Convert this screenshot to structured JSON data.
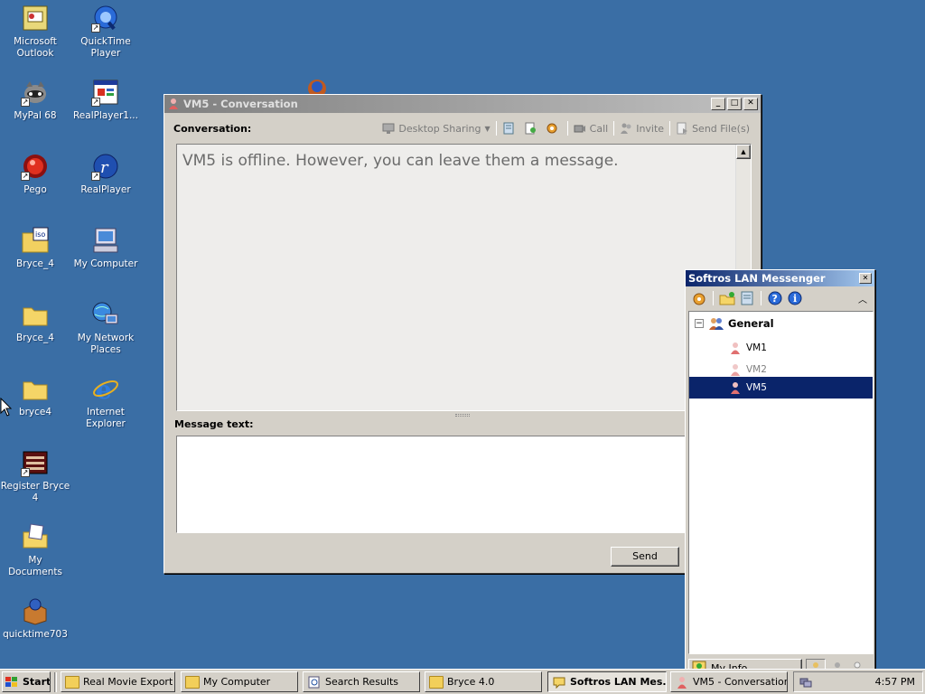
{
  "desktop": {
    "icons": [
      {
        "label": "Microsoft Outlook"
      },
      {
        "label": "QuickTime Player"
      },
      {
        "label": "MyPal 68"
      },
      {
        "label": "RealPlayer1..."
      },
      {
        "label": "Pego"
      },
      {
        "label": "RealPlayer"
      },
      {
        "label": "Bryce_4"
      },
      {
        "label": "My Computer"
      },
      {
        "label": "Bryce_4"
      },
      {
        "label": "My Network Places"
      },
      {
        "label": "bryce4"
      },
      {
        "label": "Internet Explorer"
      },
      {
        "label": "Register Bryce 4"
      },
      {
        "label": "My Documents"
      },
      {
        "label": "quicktime703"
      }
    ],
    "iso_badge": "iso"
  },
  "conversation_window": {
    "title": "VM5 - Conversation",
    "conversation_label": "Conversation:",
    "toolbar": {
      "desktop_sharing": "Desktop Sharing",
      "call": "Call",
      "invite": "Invite",
      "send_files": "Send File(s)"
    },
    "offline_message": "VM5 is offline. However, you can leave them a message.",
    "message_label": "Message text:",
    "message_value": "",
    "send_label": "Send"
  },
  "messenger_window": {
    "title": "Softros LAN Messenger",
    "group": "General",
    "contacts": [
      {
        "name": "VM1",
        "status": "online",
        "selected": false
      },
      {
        "name": "VM2",
        "status": "offline",
        "selected": false
      },
      {
        "name": "VM5",
        "status": "offline",
        "selected": true
      }
    ],
    "my_info_label": "My Info"
  },
  "taskbar": {
    "start_label": "Start",
    "tasks": [
      {
        "label": "Real Movie Export"
      },
      {
        "label": "My Computer"
      },
      {
        "label": "Search Results"
      },
      {
        "label": "Bryce 4.0"
      },
      {
        "label": "Softros LAN Mes..."
      },
      {
        "label": "VM5 - Conversation"
      }
    ],
    "clock": "4:57 PM"
  },
  "colors": {
    "desktop": "#3a6ea5",
    "selection": "#0a246a",
    "window_face": "#d4d0c8"
  }
}
